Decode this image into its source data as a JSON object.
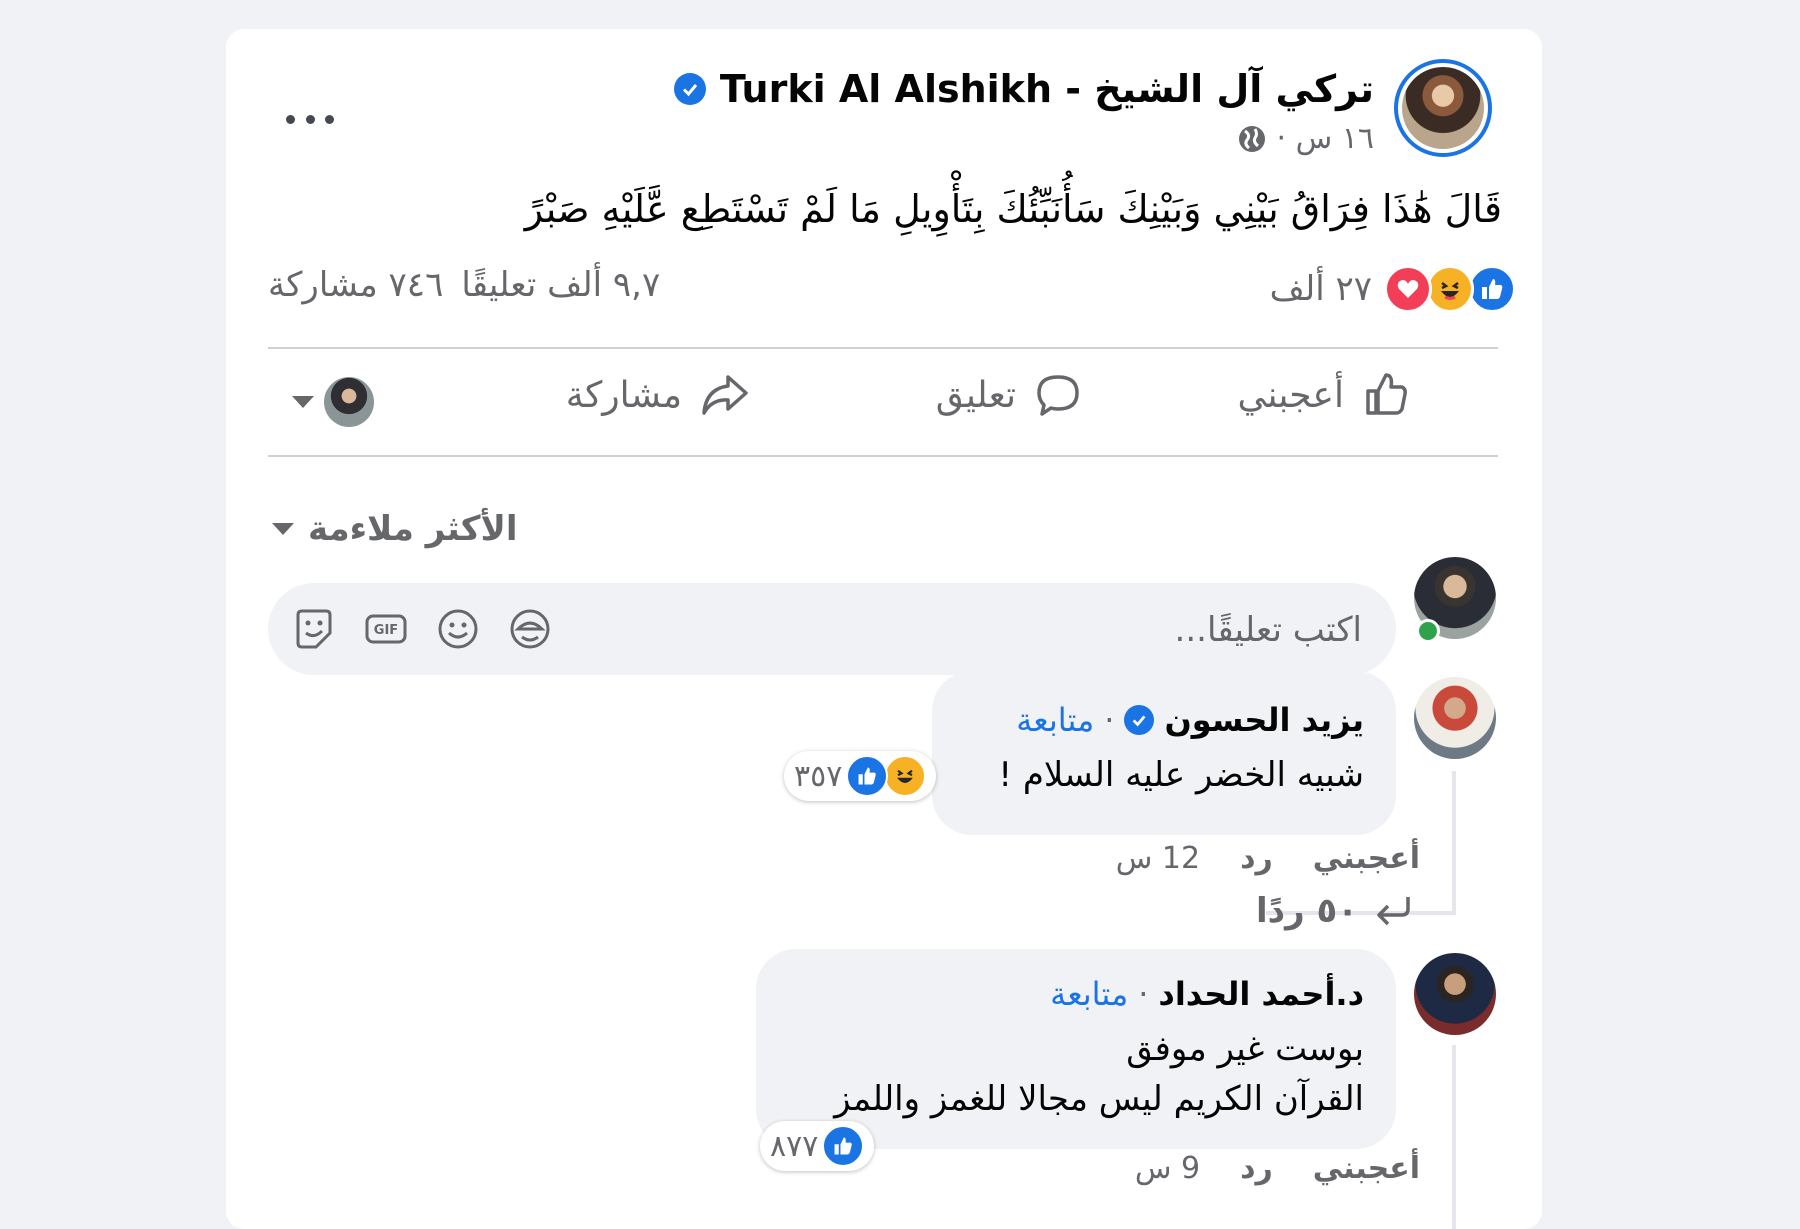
{
  "post": {
    "author": "تركي آل الشيخ - Turki Al Alshikh",
    "time": "١٦ س ·",
    "text": "قَالَ هَٰذَا فِرَاقُ بَيْنِي وَبَيْنِكَ سَأُنَبِّئُكَ بِتَأْوِيلِ مَا لَمْ تَسْتَطِع عَّلَيْهِ صَبْرً",
    "reactions_count": "٢٧ ألف",
    "comments_count": "٩,٧ ألف تعليقًا",
    "shares_count": "٧٤٦ مشاركة"
  },
  "actions": {
    "like": "أعجبني",
    "comment": "تعليق",
    "share": "مشاركة"
  },
  "sort_label": "الأكثر ملاءمة",
  "composer": {
    "placeholder": "اكتب تعليقًا..."
  },
  "comments": [
    {
      "name": "يزيد الحسون",
      "follow": "متابعة",
      "text": "شبيه الخضر عليه السلام !",
      "reaction_count": "٣٥٧",
      "like": "أعجبني",
      "reply": "رد",
      "time": "12 س",
      "replies": "٥٠ ردًا"
    },
    {
      "name": "د.أحمد الحداد",
      "follow": "متابعة",
      "line1": "بوست غير موفق",
      "line2": "القرآن الكريم ليس مجالا للغمز واللمز",
      "reaction_count": "٨٧٧",
      "like": "أعجبني",
      "reply": "رد",
      "time": "9 س"
    }
  ],
  "colors": {
    "accent": "#1b74e4",
    "muted": "#65676b",
    "background": "#f0f2f5"
  },
  "icons": [
    "verified-icon",
    "globe-icon",
    "more-icon",
    "like-icon",
    "haha-icon",
    "love-icon",
    "thumb-icon",
    "comment-icon",
    "share-icon",
    "sticker-icon",
    "gif-icon",
    "emoji-icon",
    "avatar-sticker-icon",
    "reply-arrow-icon"
  ]
}
